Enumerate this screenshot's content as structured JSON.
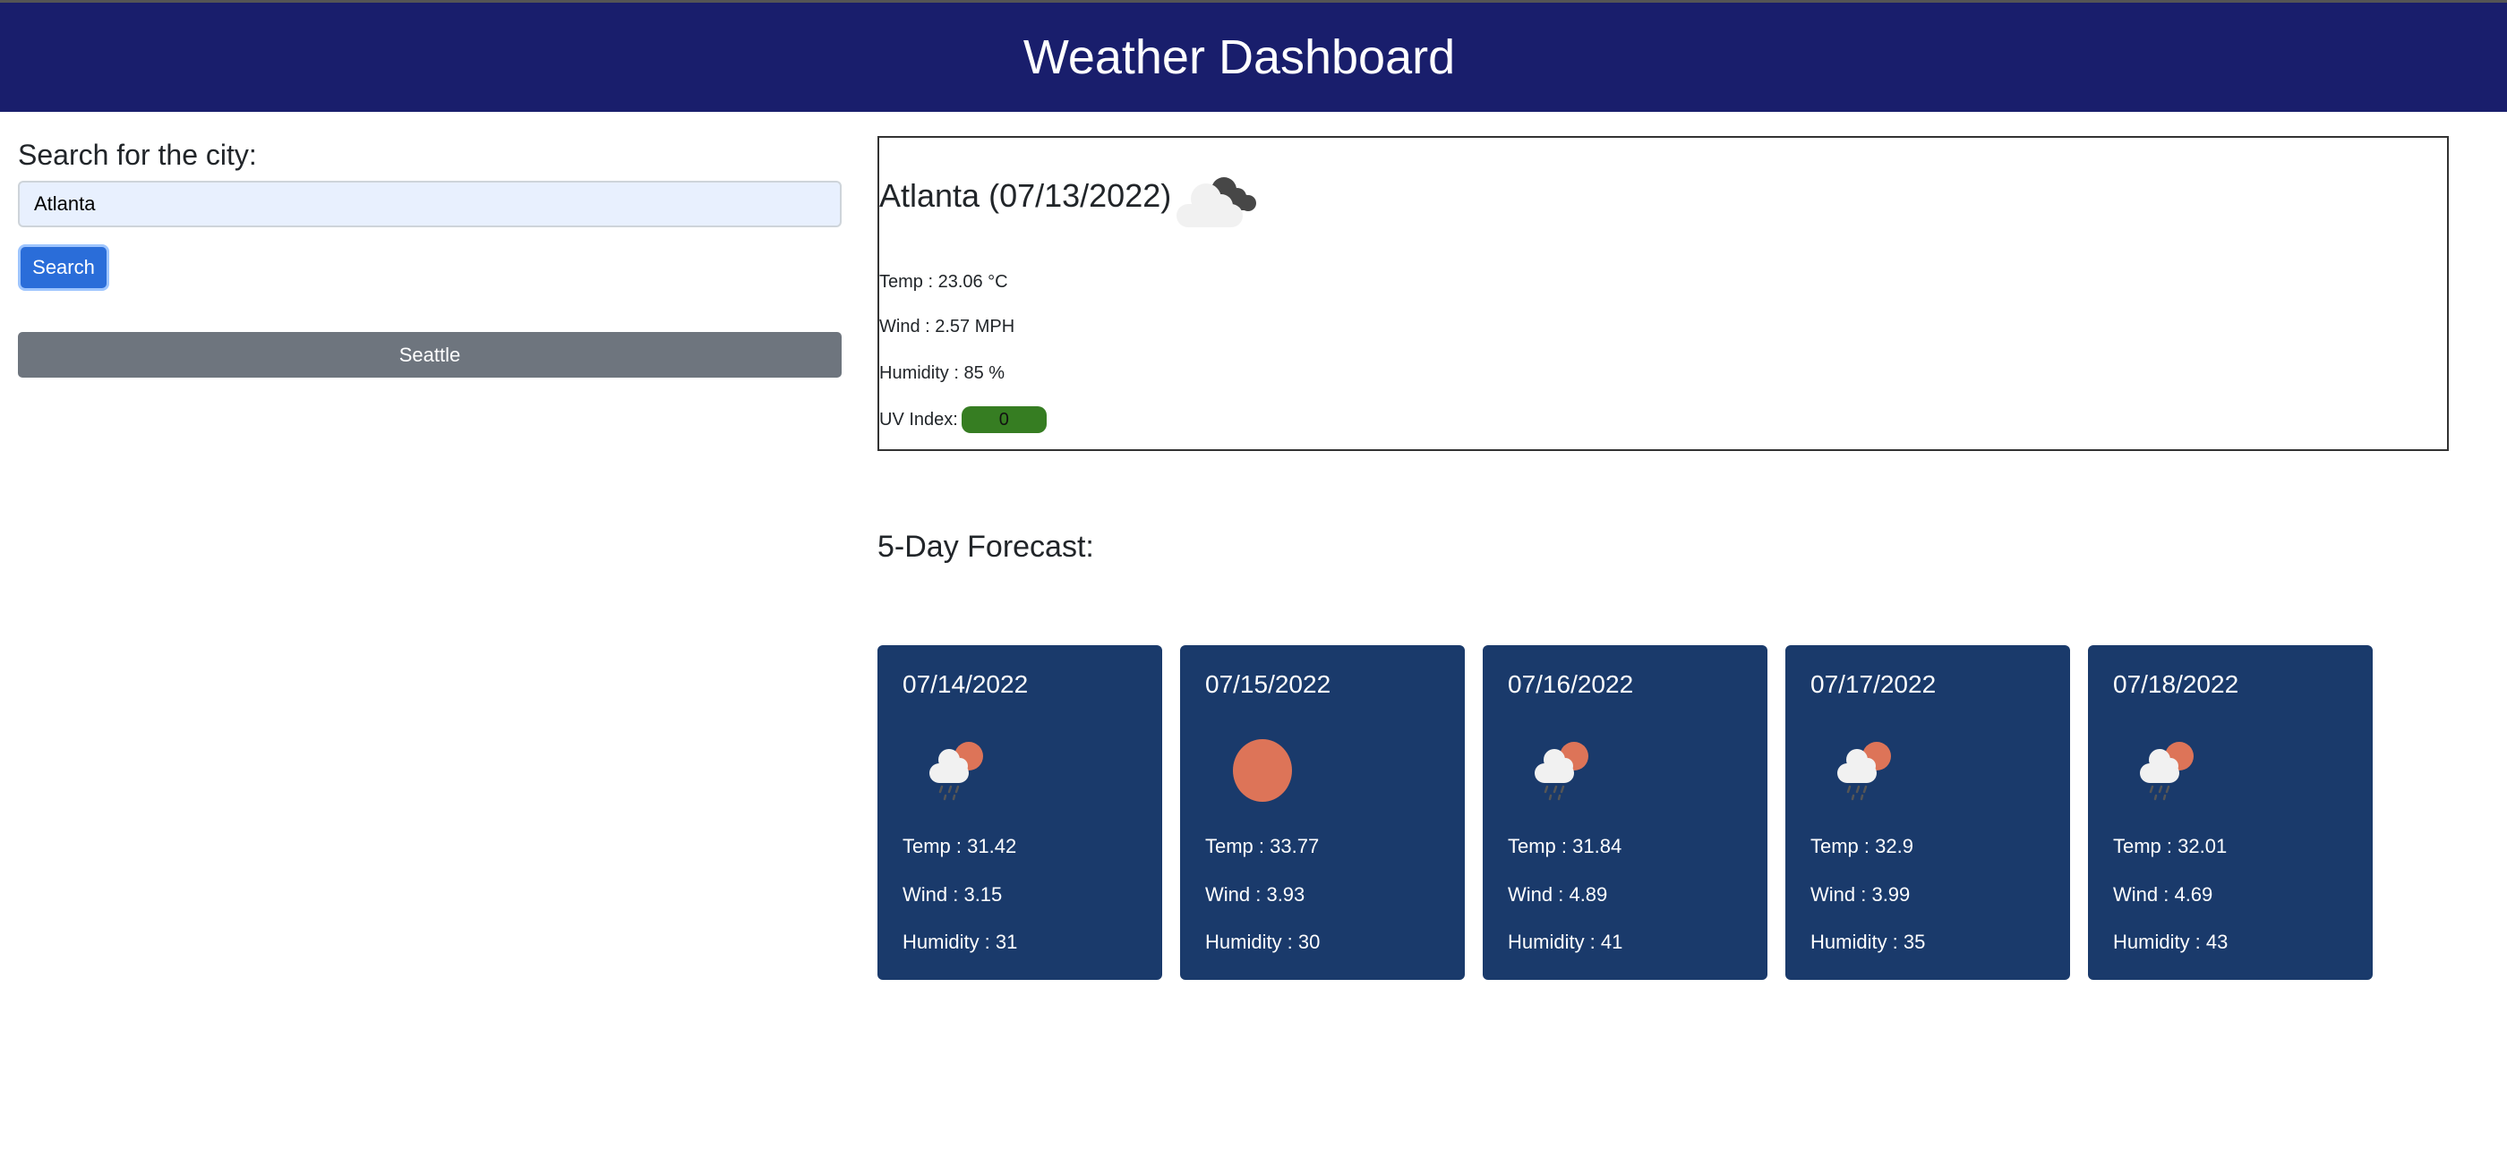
{
  "header": {
    "title": "Weather Dashboard"
  },
  "search": {
    "label": "Search for the city:",
    "value": "Atlanta",
    "button": "Search",
    "history": [
      "Seattle"
    ]
  },
  "current": {
    "heading": "Atlanta (07/13/2022)",
    "icon": "broken-clouds-icon",
    "temp": "Temp : 23.06 °C",
    "wind": "Wind : 2.57 MPH",
    "humidity": "Humidity : 85 %",
    "uv_label": "UV Index:",
    "uv_value": "0",
    "uv_color": "#367d22"
  },
  "forecast": {
    "title": "5-Day Forecast:",
    "days": [
      {
        "date": "07/14/2022",
        "icon": "rain-sun-icon",
        "temp": "Temp : 31.42",
        "wind": "Wind : 3.15",
        "humidity": "Humidity : 31"
      },
      {
        "date": "07/15/2022",
        "icon": "sun-icon",
        "temp": "Temp : 33.77",
        "wind": "Wind : 3.93",
        "humidity": "Humidity : 30"
      },
      {
        "date": "07/16/2022",
        "icon": "rain-sun-icon",
        "temp": "Temp : 31.84",
        "wind": "Wind : 4.89",
        "humidity": "Humidity : 41"
      },
      {
        "date": "07/17/2022",
        "icon": "rain-sun-icon",
        "temp": "Temp : 32.9",
        "wind": "Wind : 3.99",
        "humidity": "Humidity : 35"
      },
      {
        "date": "07/18/2022",
        "icon": "rain-sun-icon",
        "temp": "Temp : 32.01",
        "wind": "Wind : 4.69",
        "humidity": "Humidity : 43"
      }
    ]
  }
}
